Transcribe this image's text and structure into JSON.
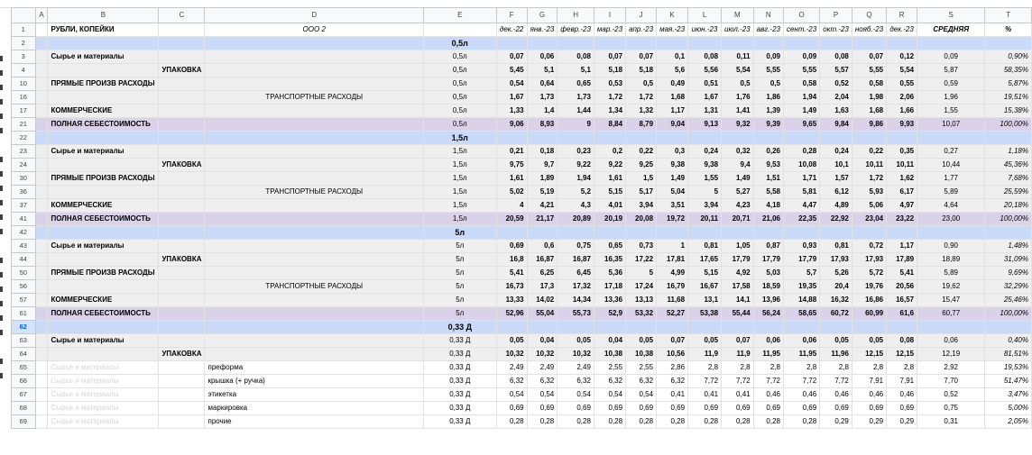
{
  "columns": [
    "A",
    "B",
    "C",
    "D",
    "E",
    "F",
    "G",
    "H",
    "I",
    "J",
    "K",
    "L",
    "M",
    "N",
    "O",
    "P",
    "Q",
    "R",
    "S",
    "T"
  ],
  "header_row": {
    "num": "1",
    "title": "РУБЛИ, КОПЕЙКИ",
    "company": "ООО 2",
    "months": [
      "дек.-22",
      "янв.-23",
      "февр.-23",
      "мар.-23",
      "апр.-23",
      "мая.-23",
      "июн.-23",
      "июл.-23",
      "авг.-23",
      "сент.-23",
      "окт.-23",
      "нояб.-23",
      "дек.-23"
    ],
    "avg": "СРЕДНЯЯ",
    "pct": "%"
  },
  "rows": [
    {
      "num": "2",
      "kind": "section",
      "label": "0,5л"
    },
    {
      "num": "3",
      "kind": "gray",
      "level": "B",
      "label": "Сырье и материалы",
      "unit": "0,5л",
      "values": [
        "0,07",
        "0,06",
        "0,08",
        "0,07",
        "0,07",
        "0,1",
        "0,08",
        "0,11",
        "0,09",
        "0,09",
        "0,08",
        "0,07",
        "0,12"
      ],
      "avg": "0,09",
      "pct": "0,90%"
    },
    {
      "num": "4",
      "kind": "gray",
      "level": "C",
      "label": "УПАКОВКА",
      "unit": "0,5л",
      "values": [
        "5,45",
        "5,1",
        "5,1",
        "5,18",
        "5,18",
        "5,6",
        "5,56",
        "5,54",
        "5,55",
        "5,55",
        "5,57",
        "5,55",
        "5,54"
      ],
      "avg": "5,87",
      "pct": "58,35%"
    },
    {
      "num": "10",
      "kind": "gray",
      "level": "B",
      "label": "ПРЯМЫЕ ПРОИЗВ РАСХОДЫ",
      "unit": "0,5л",
      "values": [
        "0,54",
        "0,64",
        "0,65",
        "0,53",
        "0,5",
        "0,49",
        "0,51",
        "0,5",
        "0,5",
        "0,58",
        "0,52",
        "0,58",
        "0,55"
      ],
      "avg": "0,59",
      "pct": "5,87%"
    },
    {
      "num": "16",
      "kind": "gray",
      "level": "D",
      "label": "ТРАНСПОРТНЫЕ РАСХОДЫ",
      "unit": "0,5л",
      "values": [
        "1,67",
        "1,73",
        "1,73",
        "1,72",
        "1,72",
        "1,68",
        "1,67",
        "1,76",
        "1,86",
        "1,94",
        "2,04",
        "1,98",
        "2,06"
      ],
      "avg": "1,96",
      "pct": "19,51%"
    },
    {
      "num": "17",
      "kind": "gray",
      "level": "B",
      "label": "КОММЕРЧЕСКИЕ",
      "unit": "0,5л",
      "values": [
        "1,33",
        "1,4",
        "1,44",
        "1,34",
        "1,32",
        "1,17",
        "1,31",
        "1,41",
        "1,39",
        "1,49",
        "1,63",
        "1,68",
        "1,66"
      ],
      "avg": "1,55",
      "pct": "15,38%"
    },
    {
      "num": "21",
      "kind": "purple",
      "level": "B",
      "label": "ПОЛНАЯ СЕБЕСТОИМОСТЬ",
      "unit": "0,5л",
      "values": [
        "9,06",
        "8,93",
        "9",
        "8,84",
        "8,79",
        "9,04",
        "9,13",
        "9,32",
        "9,39",
        "9,65",
        "9,84",
        "9,86",
        "9,93"
      ],
      "avg": "10,07",
      "pct": "100,00%"
    },
    {
      "num": "22",
      "kind": "section",
      "label": "1,5л"
    },
    {
      "num": "23",
      "kind": "gray",
      "level": "B",
      "label": "Сырье и материалы",
      "unit": "1,5л",
      "values": [
        "0,21",
        "0,18",
        "0,23",
        "0,2",
        "0,22",
        "0,3",
        "0,24",
        "0,32",
        "0,26",
        "0,28",
        "0,24",
        "0,22",
        "0,35"
      ],
      "avg": "0,27",
      "pct": "1,18%"
    },
    {
      "num": "24",
      "kind": "gray",
      "level": "C",
      "label": "УПАКОВКА",
      "unit": "1,5л",
      "values": [
        "9,75",
        "9,7",
        "9,22",
        "9,22",
        "9,25",
        "9,38",
        "9,38",
        "9,4",
        "9,53",
        "10,08",
        "10,1",
        "10,11",
        "10,11"
      ],
      "avg": "10,44",
      "pct": "45,36%"
    },
    {
      "num": "30",
      "kind": "gray",
      "level": "B",
      "label": "ПРЯМЫЕ ПРОИЗВ РАСХОДЫ",
      "unit": "1,5л",
      "values": [
        "1,61",
        "1,89",
        "1,94",
        "1,61",
        "1,5",
        "1,49",
        "1,55",
        "1,49",
        "1,51",
        "1,71",
        "1,57",
        "1,72",
        "1,62"
      ],
      "avg": "1,77",
      "pct": "7,68%"
    },
    {
      "num": "36",
      "kind": "gray",
      "level": "D",
      "label": "ТРАНСПОРТНЫЕ РАСХОДЫ",
      "unit": "1,5л",
      "values": [
        "5,02",
        "5,19",
        "5,2",
        "5,15",
        "5,17",
        "5,04",
        "5",
        "5,27",
        "5,58",
        "5,81",
        "6,12",
        "5,93",
        "6,17"
      ],
      "avg": "5,89",
      "pct": "25,59%"
    },
    {
      "num": "37",
      "kind": "gray",
      "level": "B",
      "label": "КОММЕРЧЕСКИЕ",
      "unit": "1,5л",
      "values": [
        "4",
        "4,21",
        "4,3",
        "4,01",
        "3,94",
        "3,51",
        "3,94",
        "4,23",
        "4,18",
        "4,47",
        "4,89",
        "5,06",
        "4,97"
      ],
      "avg": "4,64",
      "pct": "20,18%"
    },
    {
      "num": "41",
      "kind": "purple",
      "level": "B",
      "label": "ПОЛНАЯ СЕБЕСТОИМОСТЬ",
      "unit": "1,5л",
      "values": [
        "20,59",
        "21,17",
        "20,89",
        "20,19",
        "20,08",
        "19,72",
        "20,11",
        "20,71",
        "21,06",
        "22,35",
        "22,92",
        "23,04",
        "23,22"
      ],
      "avg": "23,00",
      "pct": "100,00%"
    },
    {
      "num": "42",
      "kind": "section",
      "label": "5л"
    },
    {
      "num": "43",
      "kind": "gray",
      "level": "B",
      "label": "Сырье и материалы",
      "unit": "5л",
      "values": [
        "0,69",
        "0,6",
        "0,75",
        "0,65",
        "0,73",
        "1",
        "0,81",
        "1,05",
        "0,87",
        "0,93",
        "0,81",
        "0,72",
        "1,17"
      ],
      "avg": "0,90",
      "pct": "1,48%"
    },
    {
      "num": "44",
      "kind": "gray",
      "level": "C",
      "label": "УПАКОВКА",
      "unit": "5л",
      "values": [
        "16,8",
        "16,87",
        "16,87",
        "16,35",
        "17,22",
        "17,81",
        "17,65",
        "17,79",
        "17,79",
        "17,79",
        "17,93",
        "17,93",
        "17,89"
      ],
      "avg": "18,89",
      "pct": "31,09%"
    },
    {
      "num": "50",
      "kind": "gray",
      "level": "B",
      "label": "ПРЯМЫЕ ПРОИЗВ РАСХОДЫ",
      "unit": "5л",
      "values": [
        "5,41",
        "6,25",
        "6,45",
        "5,36",
        "5",
        "4,99",
        "5,15",
        "4,92",
        "5,03",
        "5,7",
        "5,26",
        "5,72",
        "5,41"
      ],
      "avg": "5,89",
      "pct": "9,69%"
    },
    {
      "num": "56",
      "kind": "gray",
      "level": "D",
      "label": "ТРАНСПОРТНЫЕ РАСХОДЫ",
      "unit": "5л",
      "values": [
        "16,73",
        "17,3",
        "17,32",
        "17,18",
        "17,24",
        "16,79",
        "16,67",
        "17,58",
        "18,59",
        "19,35",
        "20,4",
        "19,76",
        "20,56"
      ],
      "avg": "19,62",
      "pct": "32,29%"
    },
    {
      "num": "57",
      "kind": "gray",
      "level": "B",
      "label": "КОММЕРЧЕСКИЕ",
      "unit": "5л",
      "values": [
        "13,33",
        "14,02",
        "14,34",
        "13,36",
        "13,13",
        "11,68",
        "13,1",
        "14,1",
        "13,96",
        "14,88",
        "16,32",
        "16,86",
        "16,57"
      ],
      "avg": "15,47",
      "pct": "25,46%"
    },
    {
      "num": "61",
      "kind": "purple",
      "level": "B",
      "label": "ПОЛНАЯ СЕБЕСТОИМОСТЬ",
      "unit": "5л",
      "values": [
        "52,96",
        "55,04",
        "55,73",
        "52,9",
        "53,32",
        "52,27",
        "53,38",
        "55,44",
        "56,24",
        "58,65",
        "60,72",
        "60,99",
        "61,6"
      ],
      "avg": "60,77",
      "pct": "100,00%"
    },
    {
      "num": "62",
      "kind": "section",
      "label": "0,33 Д",
      "active": true
    },
    {
      "num": "63",
      "kind": "gray",
      "level": "B",
      "label": "Сырье и материалы",
      "unit": "0,33 Д",
      "values": [
        "0,05",
        "0,04",
        "0,05",
        "0,04",
        "0,05",
        "0,07",
        "0,05",
        "0,07",
        "0,06",
        "0,06",
        "0,05",
        "0,05",
        "0,08"
      ],
      "avg": "0,06",
      "pct": "0,40%"
    },
    {
      "num": "64",
      "kind": "gray",
      "level": "C",
      "label": "УПАКОВКА",
      "unit": "0,33 Д",
      "values": [
        "10,32",
        "10,32",
        "10,32",
        "10,38",
        "10,38",
        "10,56",
        "11,9",
        "11,9",
        "11,95",
        "11,95",
        "11,96",
        "12,15",
        "12,15"
      ],
      "avg": "12,19",
      "pct": "81,51%"
    },
    {
      "num": "65",
      "kind": "plain",
      "ghost": "Сырье и материалы",
      "label": "преформа",
      "unit": "0,33 Д",
      "values": [
        "2,49",
        "2,49",
        "2,49",
        "2,55",
        "2,55",
        "2,86",
        "2,8",
        "2,8",
        "2,8",
        "2,8",
        "2,8",
        "2,8",
        "2,8"
      ],
      "avg": "2,92",
      "pct": "19,53%"
    },
    {
      "num": "66",
      "kind": "plain",
      "ghost": "Сырье и материалы",
      "label": "крышка (+ ручка)",
      "unit": "0,33 Д",
      "values": [
        "6,32",
        "6,32",
        "6,32",
        "6,32",
        "6,32",
        "6,32",
        "7,72",
        "7,72",
        "7,72",
        "7,72",
        "7,72",
        "7,91",
        "7,91"
      ],
      "avg": "7,70",
      "pct": "51,47%"
    },
    {
      "num": "67",
      "kind": "plain",
      "ghost": "Сырье и материалы",
      "label": "этикетка",
      "unit": "0,33 Д",
      "values": [
        "0,54",
        "0,54",
        "0,54",
        "0,54",
        "0,54",
        "0,41",
        "0,41",
        "0,41",
        "0,46",
        "0,46",
        "0,46",
        "0,46",
        "0,46"
      ],
      "avg": "0,52",
      "pct": "3,47%"
    },
    {
      "num": "68",
      "kind": "plain",
      "ghost": "Сырье и материалы",
      "label": "маркировка",
      "unit": "0,33 Д",
      "values": [
        "0,69",
        "0,69",
        "0,69",
        "0,69",
        "0,69",
        "0,69",
        "0,69",
        "0,69",
        "0,69",
        "0,69",
        "0,69",
        "0,69",
        "0,69"
      ],
      "avg": "0,75",
      "pct": "5,00%"
    },
    {
      "num": "69",
      "kind": "plain",
      "ghost": "Сырье и материалы",
      "label": "прочие",
      "unit": "0,33 Д",
      "values": [
        "0,28",
        "0,28",
        "0,28",
        "0,28",
        "0,28",
        "0,28",
        "0,28",
        "0,28",
        "0,28",
        "0,28",
        "0,29",
        "0,29",
        "0,29"
      ],
      "avg": "0,31",
      "pct": "2,05%"
    }
  ]
}
